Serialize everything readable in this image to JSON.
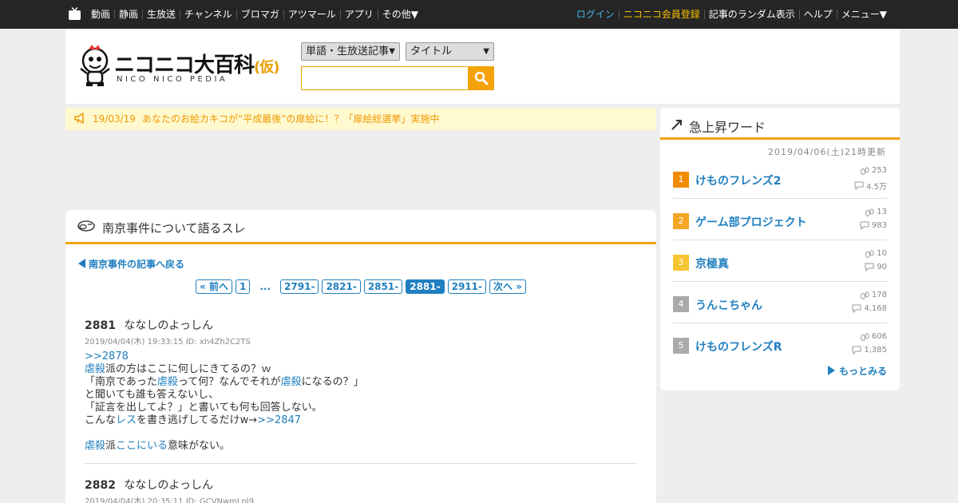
{
  "topbar": {
    "left_items": [
      "動画",
      "静画",
      "生放送",
      "チャンネル",
      "ブロマガ",
      "アツマール",
      "アプリ",
      "その他▼"
    ],
    "login": "ログイン",
    "register": "ニコニコ会員登録",
    "right_items": [
      "記事のランダム表示",
      "ヘルプ",
      "メニュー▼"
    ]
  },
  "header": {
    "logo_title": "ニコニコ大百科",
    "logo_kakko": "(仮)",
    "logo_sub": "NICO NICO PEDIA",
    "select_type": "単語・生放送記事",
    "select_target": "タイトル",
    "search_value": ""
  },
  "news": {
    "date": "19/03/19",
    "text": "あなたのお絵カキコが“平成最後”の扉絵に！？「扉絵総選挙」実施中"
  },
  "thread": {
    "title": "南京事件について語るスレ",
    "back_link": "南京事件の記事へ戻る",
    "pager": {
      "prev": "« 前へ",
      "first": "1",
      "dots": "...",
      "pages": [
        "2791-",
        "2821-",
        "2851-",
        "2881-",
        "2911-"
      ],
      "current": "2881-",
      "next": "次へ »"
    },
    "responses": [
      {
        "no": "2881",
        "name": "ななしのよっしん",
        "meta": "2019/04/04(木) 19:33:15 ID: xh4Zh2C2TS",
        "anchor": ">>2878",
        "line1_link": "虐殺",
        "line1_text": "派の方はここに何しにきてるの？ｗ",
        "line2_a": "「南京であった",
        "line2_link1": "虐殺",
        "line2_b": "って何？なんでそれが",
        "line2_link2": "虐殺",
        "line2_c": "になるの？」",
        "line3": "と聞いても誰も答えないし、",
        "line4": "「証言を出してよ？」と書いても何も回答しない。",
        "line5_a": "こんな",
        "line5_link": "レス",
        "line5_b": "を書き逃げしてるだけw→",
        "line5_anchor": ">>2847",
        "line6_link1": "虐殺",
        "line6_a": "派",
        "line6_link2": "ここにいる",
        "line6_b": "意味がない。"
      },
      {
        "no": "2882",
        "name": "ななしのよっしん",
        "meta": "2019/04/04(木) 20:35:11 ID: GCVNwmLpJ9"
      }
    ]
  },
  "ranking": {
    "title": "急上昇ワード",
    "updated": "2019/04/06(土)21時更新",
    "items": [
      {
        "rank": "1",
        "name": "けものフレンズ2",
        "views": "253",
        "comments": "4.5万",
        "color": "#f08c00"
      },
      {
        "rank": "2",
        "name": "ゲーム部プロジェクト",
        "views": "13",
        "comments": "983",
        "color": "#f5a623"
      },
      {
        "rank": "3",
        "name": "京極真",
        "views": "10",
        "comments": "90",
        "color": "#f7c531"
      },
      {
        "rank": "4",
        "name": "うんこちゃん",
        "views": "178",
        "comments": "4,168",
        "color": "#aaaaaa"
      },
      {
        "rank": "5",
        "name": "けものフレンズR",
        "views": "606",
        "comments": "1,385",
        "color": "#aaaaaa"
      }
    ],
    "more": "もっとみる"
  }
}
